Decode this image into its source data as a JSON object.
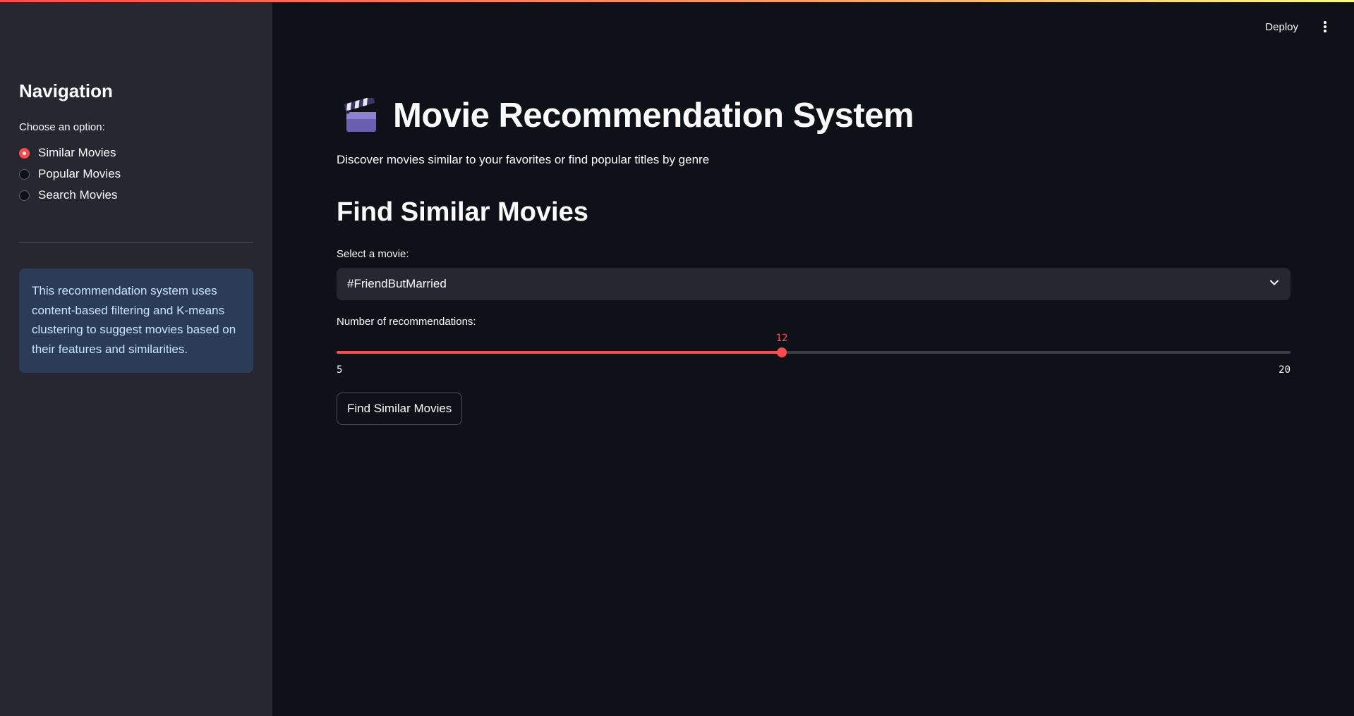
{
  "sidebar": {
    "heading": "Navigation",
    "radio_label": "Choose an option:",
    "options": [
      {
        "label": "Similar Movies",
        "checked": true
      },
      {
        "label": "Popular Movies",
        "checked": false
      },
      {
        "label": "Search Movies",
        "checked": false
      }
    ],
    "info_text": "This recommendation system uses content-based filtering and K-means clustering to suggest movies based on their features and similarities."
  },
  "header": {
    "deploy_label": "Deploy",
    "menu_icon": "kebab-menu-icon"
  },
  "main": {
    "title_icon": "clapper-board-icon",
    "title": "Movie Recommendation System",
    "subtitle": "Discover movies similar to your favorites or find popular titles by genre",
    "section_title": "Find Similar Movies",
    "movie_select": {
      "label": "Select a movie:",
      "value": "#FriendButMarried"
    },
    "slider": {
      "label": "Number of recommendations:",
      "min": 5,
      "max": 20,
      "value": 12
    },
    "submit_label": "Find Similar Movies"
  },
  "colors": {
    "accent": "#ff4b4b",
    "background": "#0e1117",
    "sidebar_bg": "#262730",
    "info_bg": "#2b3d56",
    "info_text": "#c7e4fb"
  }
}
